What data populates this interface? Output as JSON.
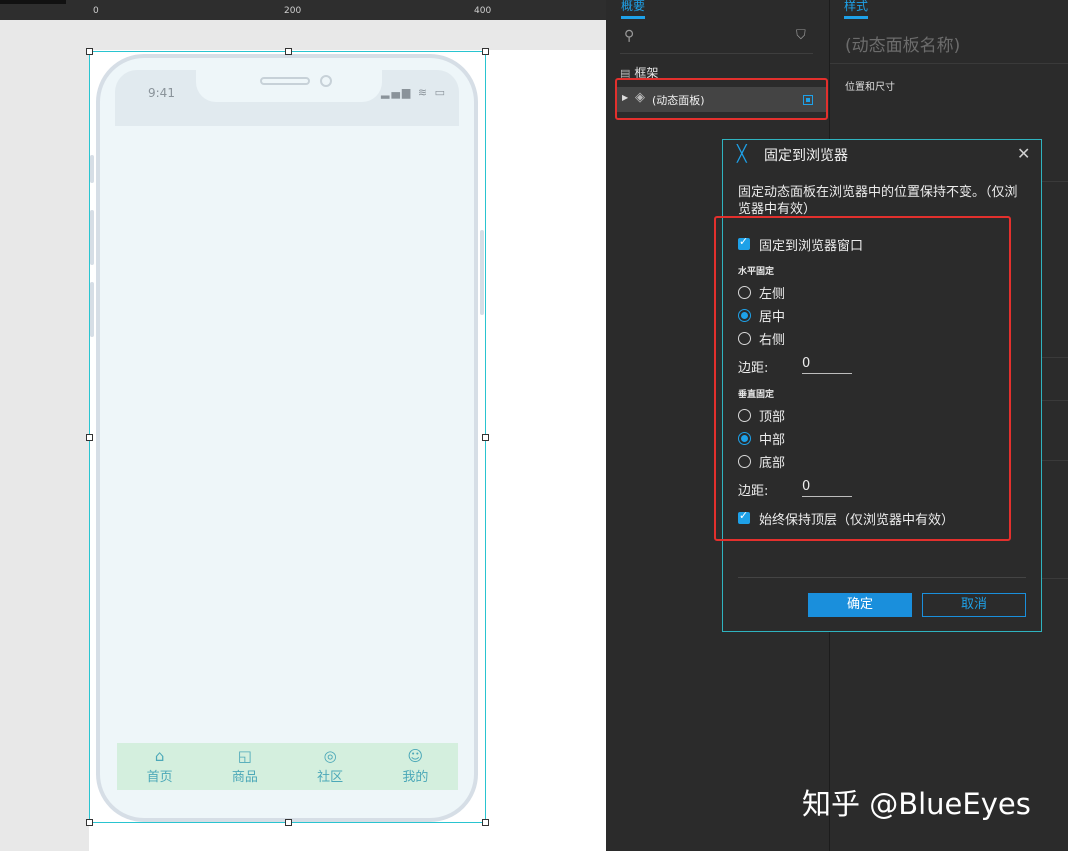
{
  "ruler": {
    "marks": [
      "0",
      "200",
      "400"
    ]
  },
  "phone": {
    "time": "9:41",
    "status_icons": "▂▄▆ ≋ ▭",
    "tabs": [
      {
        "label": "首页",
        "icon": "home-icon",
        "glyph": "⌂"
      },
      {
        "label": "商品",
        "icon": "bag-icon",
        "glyph": "◱"
      },
      {
        "label": "社区",
        "icon": "planet-icon",
        "glyph": "◎"
      },
      {
        "label": "我的",
        "icon": "user-icon",
        "glyph": "☺"
      }
    ]
  },
  "outline_panel": {
    "tab": "概要",
    "frame_label": "框架",
    "layer_label": "(动态面板)"
  },
  "style_panel": {
    "tab": "样式",
    "name_placeholder": "(动态面板名称)",
    "position_size": "位置和尺寸"
  },
  "dialog": {
    "title": "固定到浏览器",
    "description": "固定动态面板在浏览器中的位置保持不变。（仅浏览器中有效）",
    "pin_checkbox": "固定到浏览器窗口",
    "horizontal": {
      "label": "水平固定",
      "options": [
        "左侧",
        "居中",
        "右侧"
      ],
      "selected": "居中",
      "margin_label": "边距:",
      "margin_value": "0"
    },
    "vertical": {
      "label": "垂直固定",
      "options": [
        "顶部",
        "中部",
        "底部"
      ],
      "selected": "中部",
      "margin_label": "边距:",
      "margin_value": "0"
    },
    "top_checkbox": "始终保持顶层（仅浏览器中有效）",
    "ok": "确定",
    "cancel": "取消"
  },
  "watermark": "知乎 @BlueEyes",
  "colors": {
    "accent": "#1ea1e8",
    "highlight": "#e3302d",
    "selection": "#29c4d0",
    "tabbar": "#d4efde"
  }
}
